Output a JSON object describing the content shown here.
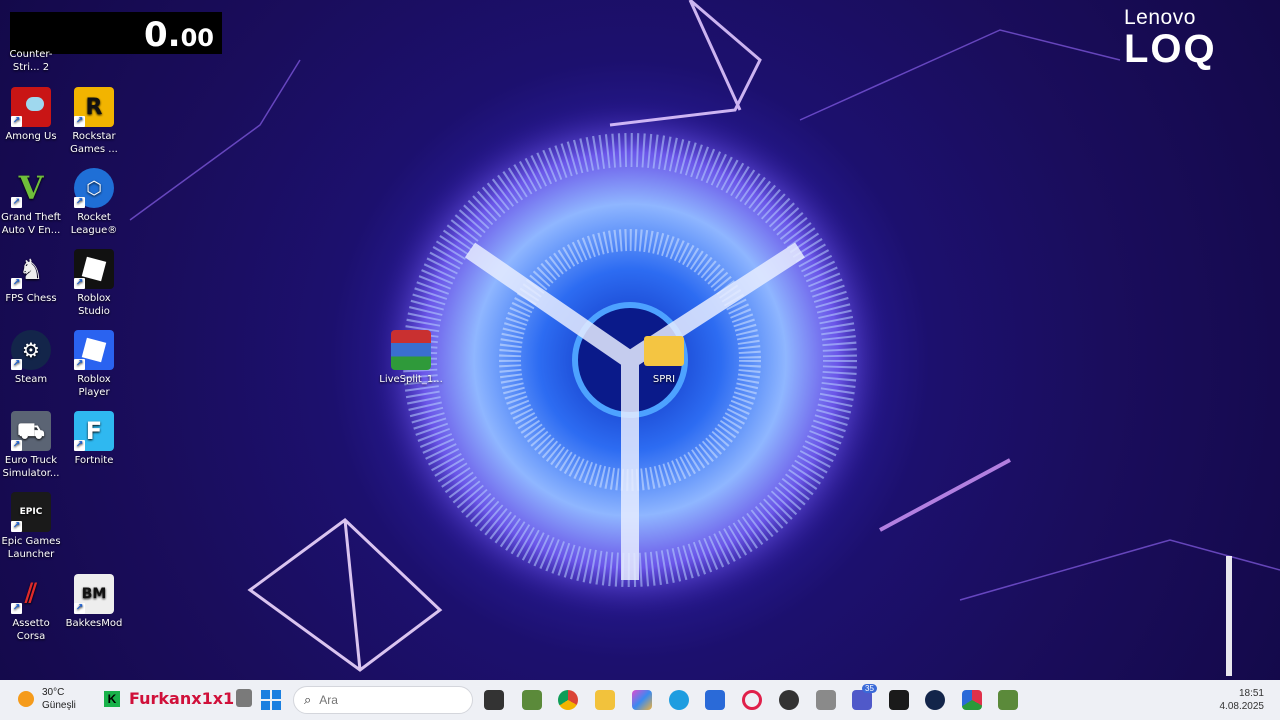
{
  "timer": {
    "main": "0.",
    "fraction": "00"
  },
  "brand": {
    "line1": "Lenovo",
    "line2": "LOQ"
  },
  "desktop_icons": [
    {
      "label": "Counter-Stri... 2"
    },
    {
      "label": "Among Us"
    },
    {
      "label": "Rockstar Games ..."
    },
    {
      "label": "Grand Theft Auto V En..."
    },
    {
      "label": "Rocket League®"
    },
    {
      "label": "FPS Chess"
    },
    {
      "label": "Roblox Studio"
    },
    {
      "label": "Steam"
    },
    {
      "label": "Roblox Player"
    },
    {
      "label": "Euro Truck Simulator..."
    },
    {
      "label": "Fortnite"
    },
    {
      "label": "Epic Games Launcher"
    },
    {
      "label": "Assetto Corsa"
    },
    {
      "label": "BakkesMod"
    },
    {
      "label": "LiveSplit_1..."
    },
    {
      "label": "SPRI"
    }
  ],
  "taskbar": {
    "weather_temp": "30°C",
    "weather_desc": "Güneşli",
    "user_name": "Furkanx1x1",
    "search_placeholder": "Ara",
    "teams_badge": "35",
    "time": "18:51",
    "date": "4.08.2025"
  }
}
